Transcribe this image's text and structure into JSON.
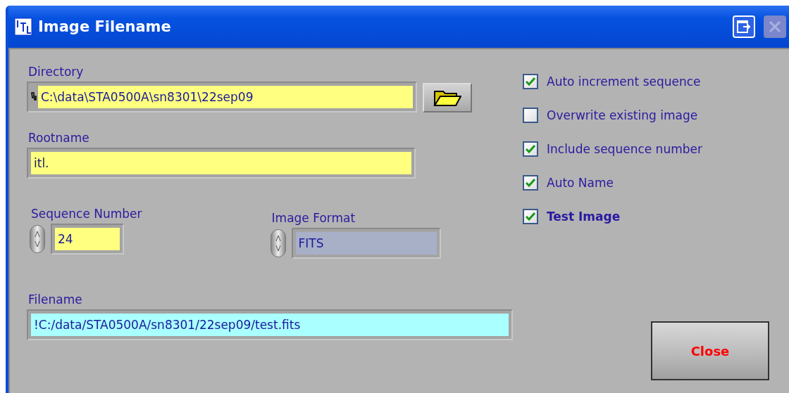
{
  "window": {
    "title": "Image Filename"
  },
  "directory": {
    "label": "Directory",
    "value": "C:\\data\\STA0500A\\sn8301\\22sep09"
  },
  "rootname": {
    "label": "Rootname",
    "value": "itl."
  },
  "sequence_number": {
    "label": "Sequence Number",
    "value": "24"
  },
  "image_format": {
    "label": "Image Format",
    "value": "FITS"
  },
  "filename": {
    "label": "Filename",
    "value": "!C:/data/STA0500A/sn8301/22sep09/test.fits"
  },
  "options": [
    {
      "label": "Auto increment sequence",
      "checked": true,
      "bold": false
    },
    {
      "label": "Overwrite existing image",
      "checked": false,
      "bold": false
    },
    {
      "label": "Include sequence number",
      "checked": true,
      "bold": false
    },
    {
      "label": "Auto Name",
      "checked": true,
      "bold": false
    },
    {
      "label": "Test Image",
      "checked": true,
      "bold": true
    }
  ],
  "buttons": [
    {
      "label": "Close"
    }
  ]
}
